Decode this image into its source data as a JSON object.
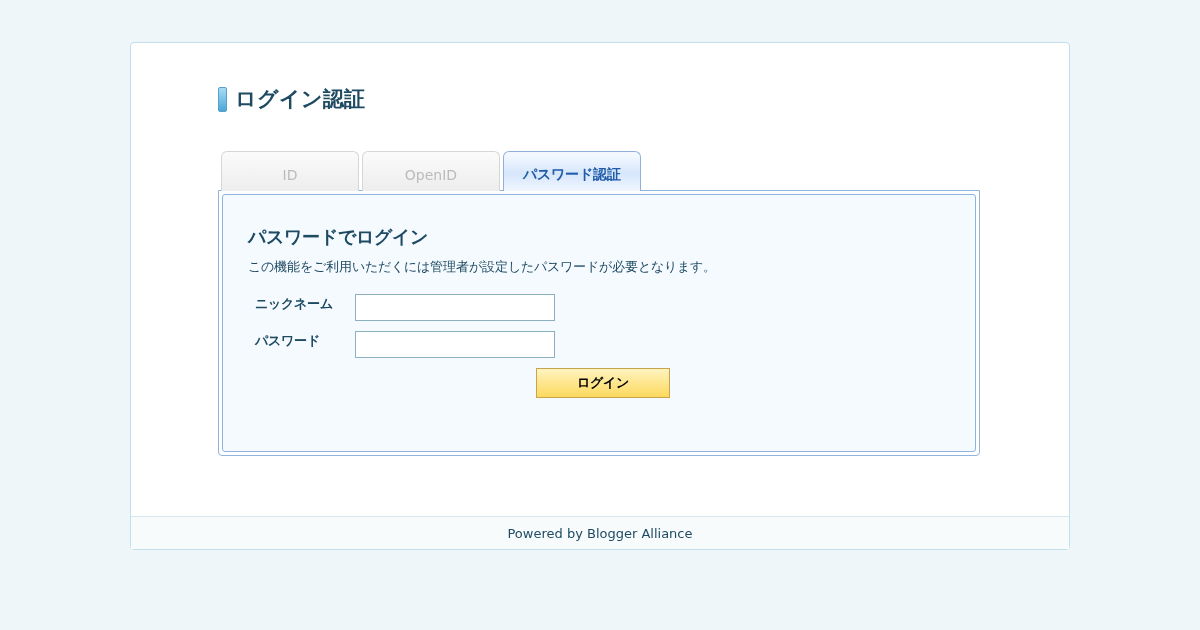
{
  "page_title": "ログイン認証",
  "tabs": [
    {
      "label": "ID",
      "selected": false
    },
    {
      "label": "OpenID",
      "selected": false
    },
    {
      "label": "パスワード認証",
      "selected": true
    }
  ],
  "panel": {
    "heading": "パスワードでログイン",
    "description": "この機能をご利用いただくには管理者が設定したパスワードが必要となります。",
    "fields": [
      {
        "label": "ニックネーム"
      },
      {
        "label": "パスワード"
      }
    ],
    "submit": "ログイン"
  },
  "footer": "Powered by Blogger Alliance"
}
